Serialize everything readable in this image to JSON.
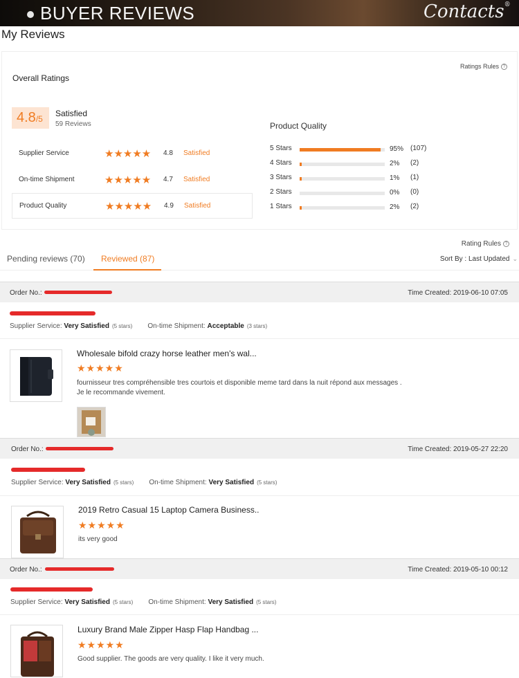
{
  "banner": {
    "title": "BUYER REVIEWS",
    "logo": "Contacts",
    "logo_mark": "®"
  },
  "page_title": "My Reviews",
  "summary": {
    "overall_label": "Overall Ratings",
    "rules_label": "Ratings Rules",
    "score": "4.8",
    "score_suffix": "/5",
    "satisfied": "Satisfied",
    "reviews_count": "59 Reviews",
    "rows": [
      {
        "label": "Supplier Service",
        "stars": "★★★★★",
        "value": "4.8",
        "status": "Satisfied"
      },
      {
        "label": "On-time Shipment",
        "stars": "★★★★★",
        "value": "4.7",
        "status": "Satisfied"
      },
      {
        "label": "Product Quality",
        "stars": "★★★★★",
        "value": "4.9",
        "status": "Satisfied"
      }
    ],
    "product_quality_title": "Product Quality",
    "distribution": [
      {
        "label": "5 Stars",
        "percent_text": "95%",
        "count": "(107)",
        "fraction": 0.95
      },
      {
        "label": "4 Stars",
        "percent_text": "2%",
        "count": "(2)",
        "fraction": 0.02
      },
      {
        "label": "3 Stars",
        "percent_text": "1%",
        "count": "(1)",
        "fraction": 0.01
      },
      {
        "label": "2 Stars",
        "percent_text": "0%",
        "count": "(0)",
        "fraction": 0.0
      },
      {
        "label": "1 Stars",
        "percent_text": "2%",
        "count": "(2)",
        "fraction": 0.02
      }
    ]
  },
  "tabs": {
    "rating_rules": "Rating Rules",
    "pending": "Pending reviews (70)",
    "reviewed": "Reviewed (87)",
    "sort_label": "Sort By : Last Updated"
  },
  "orders": [
    {
      "order_label": "Order No.:",
      "time_created": "Time Created: 2019-06-10 07:05",
      "supplier_label": "Supplier Service:",
      "supplier_value": "Very Satisfied",
      "supplier_stars": "(5 stars)",
      "shipment_label": "On-time Shipment:",
      "shipment_value": "Acceptable",
      "shipment_stars": "(3 stars)",
      "product": "Wholesale bifold crazy horse leather men's wal...",
      "stars": "★★★★★",
      "review_line1": "fournisseur tres compréhensible tres courtois et disponible meme tard dans la nuit répond aux messages .",
      "review_line2": "Je le recommande vivement."
    },
    {
      "order_label": "Order No.:",
      "time_created": "Time Created: 2019-05-27 22:20",
      "supplier_label": "Supplier Service:",
      "supplier_value": "Very Satisfied",
      "supplier_stars": "(5 stars)",
      "shipment_label": "On-time Shipment:",
      "shipment_value": "Very Satisfied",
      "shipment_stars": "(5 stars)",
      "product": "2019 Retro Casual 15 Laptop Camera Business..",
      "stars": "★★★★★",
      "review_line1": "its very good"
    },
    {
      "order_label": "Order No.:",
      "time_created": "Time Created: 2019-05-10 00:12",
      "supplier_label": "Supplier Service:",
      "supplier_value": "Very Satisfied",
      "supplier_stars": "(5 stars)",
      "shipment_label": "On-time Shipment:",
      "shipment_value": "Very Satisfied",
      "shipment_stars": "(5 stars)",
      "product": "Luxury Brand Male Zipper Hasp Flap Handbag ...",
      "stars": "★★★★★",
      "review_line1": "Good supplier. The goods are very quality. I like it very much."
    }
  ],
  "colors": {
    "accent": "#f07c22",
    "redaction": "#e52a2a"
  }
}
